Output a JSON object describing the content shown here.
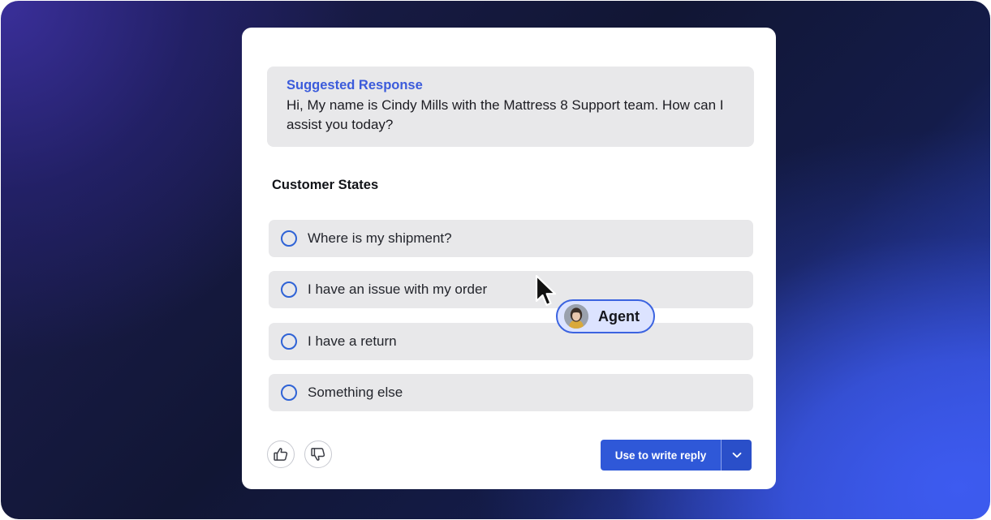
{
  "suggested_response": {
    "title": "Suggested Response",
    "text": "Hi, My name is Cindy Mills with the Mattress 8 Support team. How can I assist you today?"
  },
  "customer_states": {
    "title": "Customer States",
    "options": [
      {
        "label": "Where is my shipment?"
      },
      {
        "label": "I have an issue with my order"
      },
      {
        "label": "I have a return"
      },
      {
        "label": "Something else"
      }
    ]
  },
  "feedback": {
    "thumbs_up_icon": "thumbs-up-icon",
    "thumbs_down_icon": "thumbs-down-icon"
  },
  "actions": {
    "use_reply_label": "Use to write reply",
    "dropdown_icon": "chevron-down-icon"
  },
  "agent_tag": {
    "label": "Agent",
    "avatar_icon": "avatar"
  },
  "colors": {
    "accent": "#2f58d8",
    "title_blue": "#3b5bdb",
    "option_bg": "#e8e8ea",
    "card_bg": "#ffffff"
  }
}
